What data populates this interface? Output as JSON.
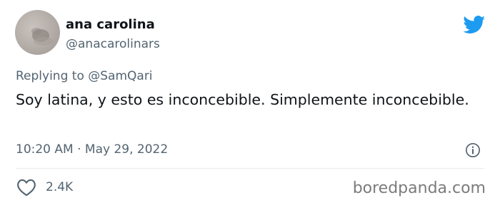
{
  "tweet": {
    "author_name": "ana carolina",
    "author_handle": "@anacarolinars",
    "replying_prefix": "Replying to ",
    "replying_mention": "@SamQari",
    "text": "Soy latina, y esto es inconcebible. Simplemente inconcebible.",
    "timestamp": "10:20 AM · May 29, 2022",
    "likes_count": "2.4K"
  },
  "icons": {
    "brand": "twitter-bird-icon",
    "info": "info-icon",
    "like": "heart-icon"
  },
  "watermark": "boredpanda.com",
  "colors": {
    "brand_blue": "#1d9bf0",
    "muted_text": "#536471",
    "main_text": "#0f1419"
  }
}
